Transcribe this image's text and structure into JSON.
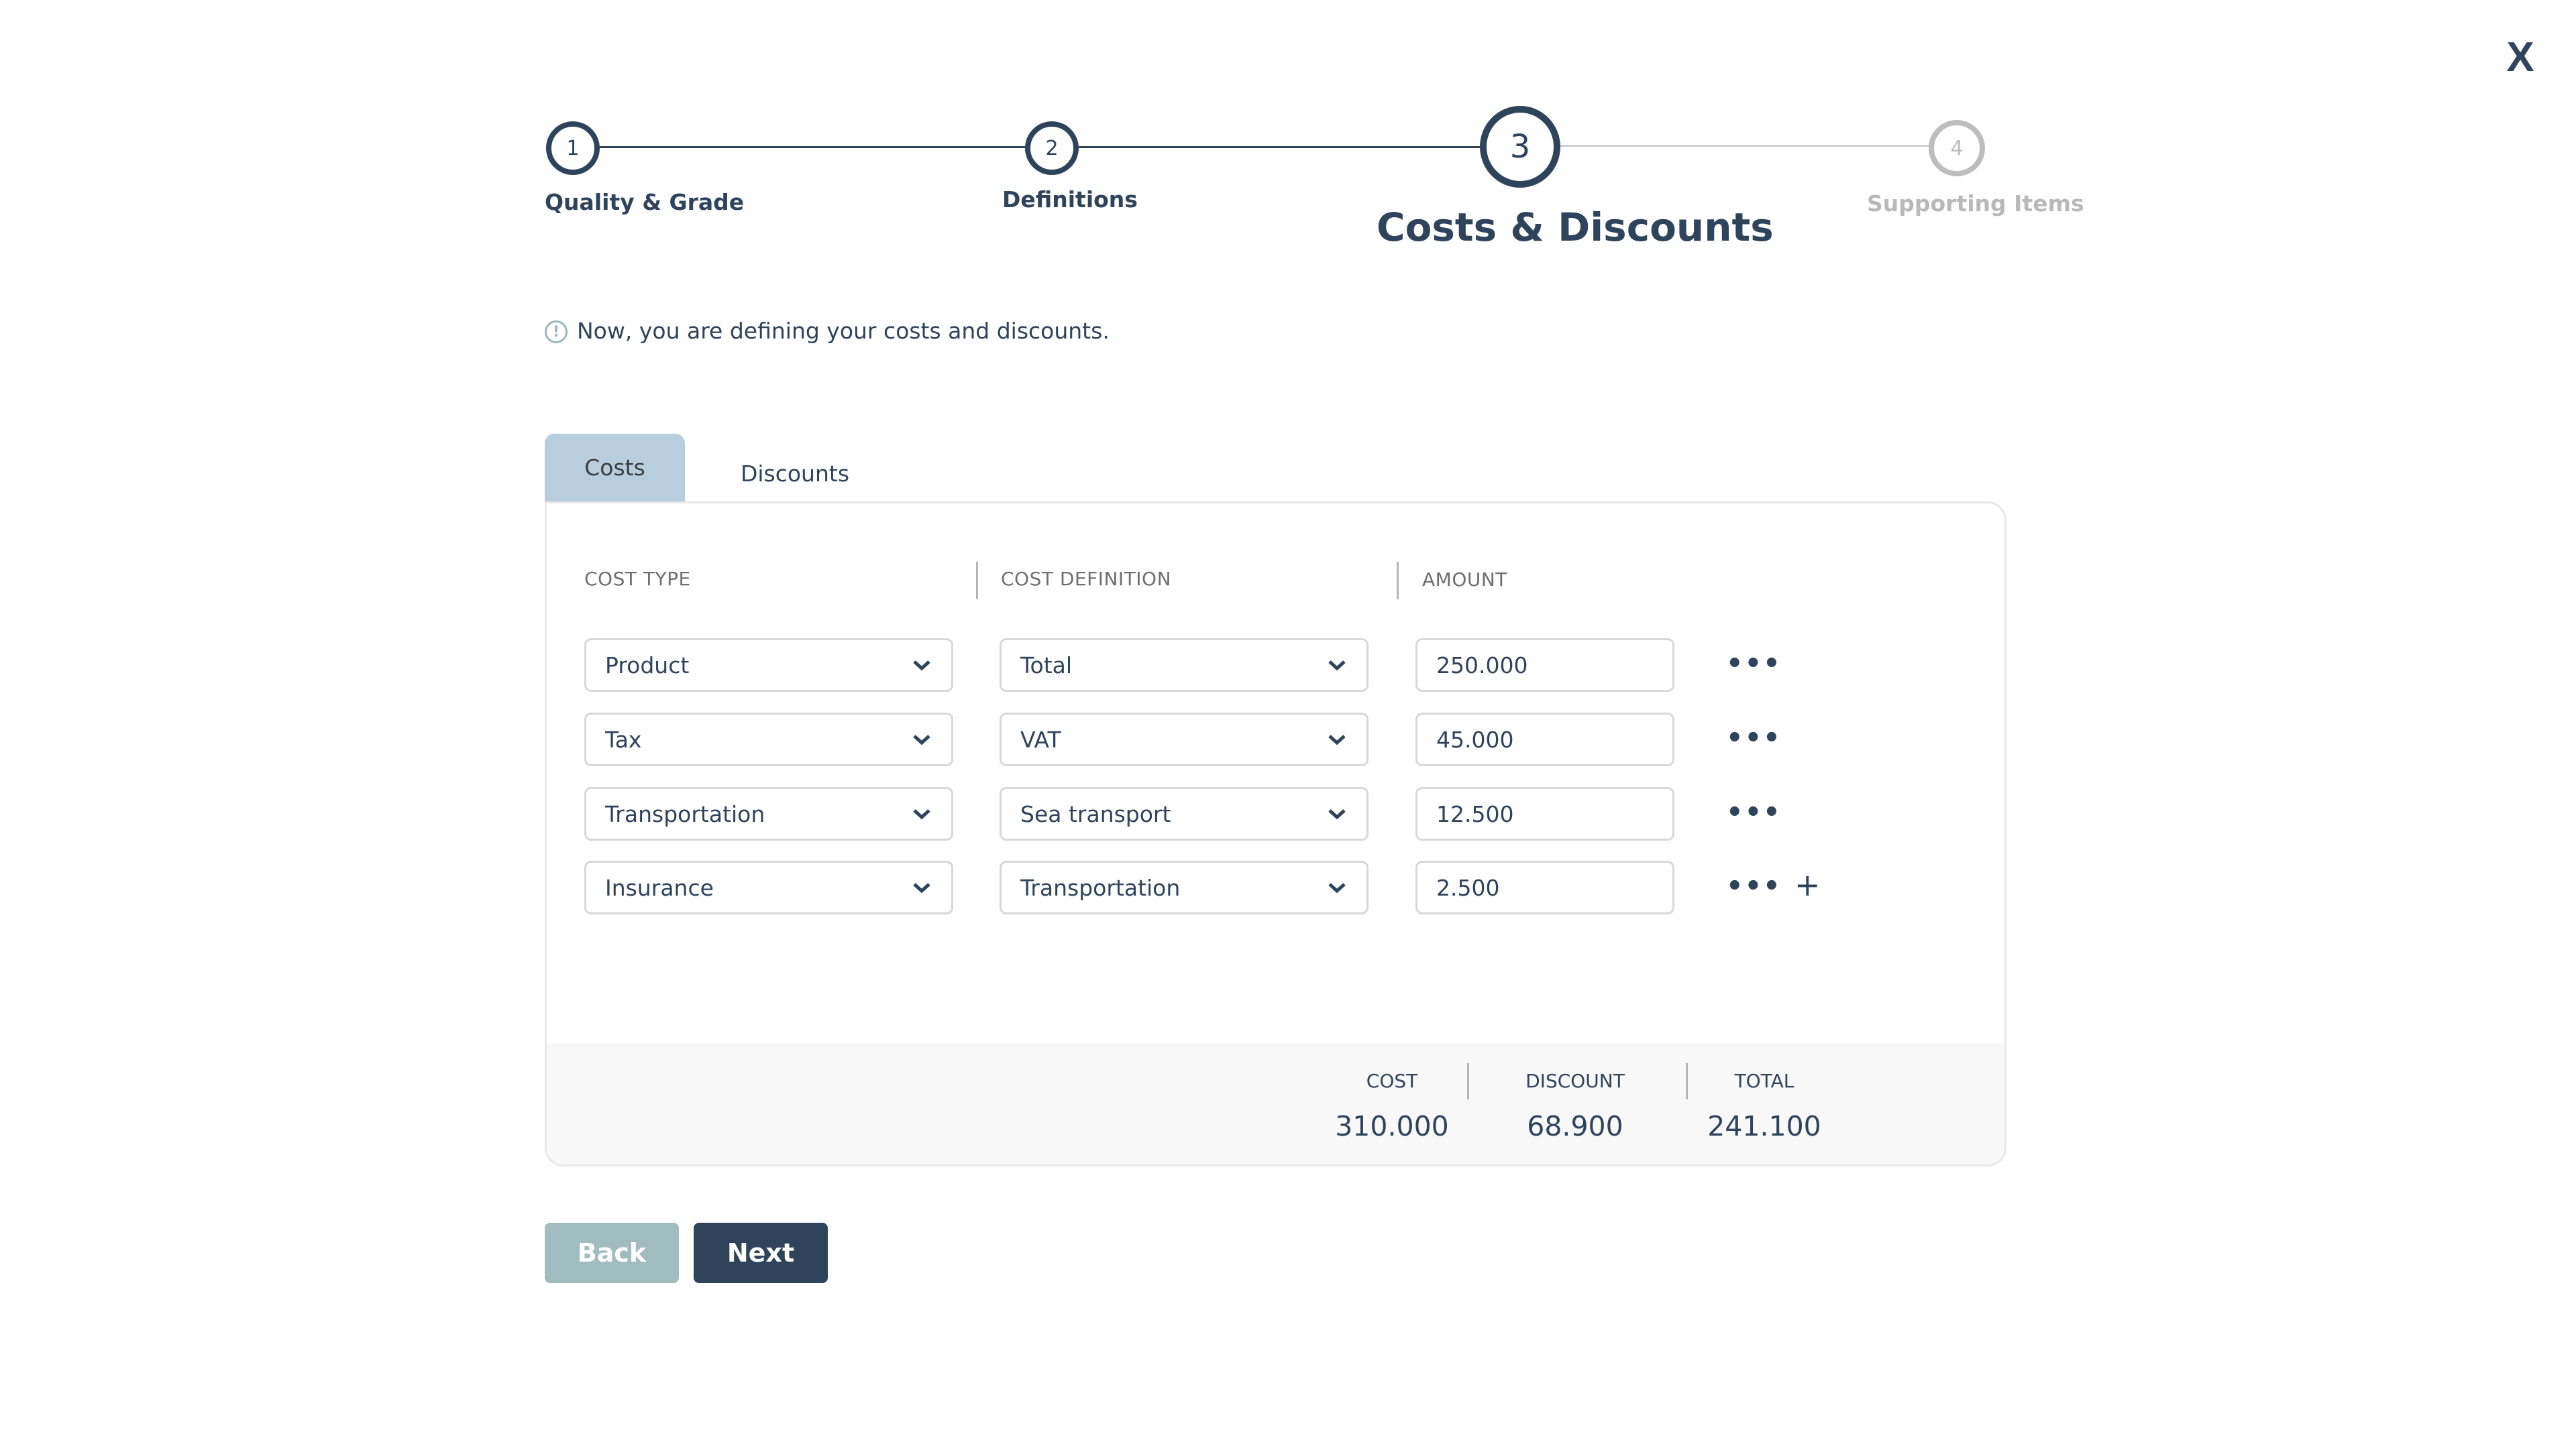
{
  "close": {
    "label": "X"
  },
  "stepper": {
    "steps": [
      {
        "number": "1",
        "label": "Quality & Grade",
        "state": "completed"
      },
      {
        "number": "2",
        "label": "Definitions",
        "state": "completed"
      },
      {
        "number": "3",
        "label": "Costs & Discounts",
        "state": "active"
      },
      {
        "number": "4",
        "label": "Supporting Items",
        "state": "upcoming"
      }
    ]
  },
  "info": {
    "icon": "exclamation-circle-icon",
    "text": "Now, you are defining your costs and discounts."
  },
  "tabs": [
    {
      "label": "Costs",
      "active": true
    },
    {
      "label": "Discounts",
      "active": false
    }
  ],
  "table": {
    "headers": {
      "cost_type": "COST TYPE",
      "cost_definition": "COST DEFINITION",
      "amount": "AMOUNT"
    },
    "rows": [
      {
        "cost_type": "Product",
        "cost_definition": "Total",
        "amount": "250.000"
      },
      {
        "cost_type": "Tax",
        "cost_definition": "VAT",
        "amount": "45.000"
      },
      {
        "cost_type": "Transportation",
        "cost_definition": "Sea transport",
        "amount": "12.500"
      },
      {
        "cost_type": "Insurance",
        "cost_definition": "Transportation",
        "amount": "2.500"
      }
    ],
    "more_icon": "•••",
    "add_icon": "+"
  },
  "summary": {
    "cost_label": "COST",
    "cost_value": "310.000",
    "discount_label": "DISCOUNT",
    "discount_value": "68.900",
    "total_label": "TOTAL",
    "total_value": "241.100"
  },
  "buttons": {
    "back": "Back",
    "next": "Next"
  },
  "colors": {
    "primary": "#2f435a",
    "tab_active": "#b8cedd",
    "back_button": "#a1bcbe",
    "inactive_step": "#bdbdbd"
  }
}
